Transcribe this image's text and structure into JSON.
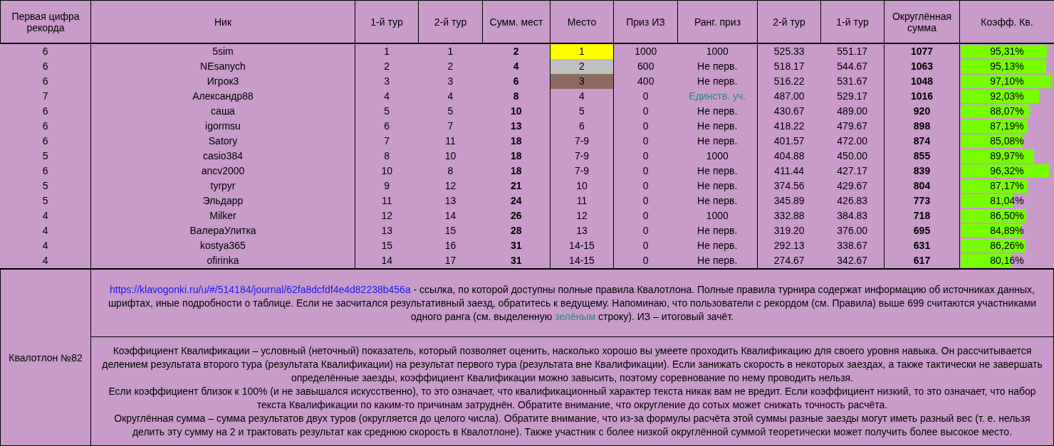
{
  "table": {
    "columns": [
      "Первая цифра рекорда",
      "Ник",
      "1-й тур",
      "2-й тур",
      "Сумм. мест",
      "Место",
      "Приз ИЗ",
      "Ранг. приз",
      "2-й тур",
      "1-й тур",
      "Округлённая сумма",
      "Коэфф. Кв."
    ],
    "rows": [
      {
        "record_digit": "6",
        "nick": "5sim",
        "round_1": "1",
        "round_2": "1",
        "sum_places": "2",
        "place": "1",
        "color": "#ffff00",
        "prize": "1000",
        "rank_prize": "1000",
        "highlighted": false,
        "score_2": "525.33",
        "score_1": "551.17",
        "rounded_sum": "1077",
        "coeff": "95,31%",
        "level": 0.915
      },
      {
        "record_digit": "6",
        "nick": "NEsanych",
        "round_1": "2",
        "round_2": "2",
        "sum_places": "4",
        "place": "2",
        "color": "#c0c0c0",
        "prize": "600",
        "rank_prize": "Не перв.",
        "highlighted": false,
        "score_2": "518.17",
        "score_1": "544.67",
        "rounded_sum": "1063",
        "coeff": "95,13%",
        "level": 0.911
      },
      {
        "record_digit": "6",
        "nick": "Игрок3",
        "round_1": "3",
        "round_2": "3",
        "sum_places": "6",
        "place": "3",
        "color": "#8b6b61",
        "prize": "400",
        "rank_prize": "Не перв.",
        "highlighted": false,
        "score_2": "516.22",
        "score_1": "531.67",
        "rounded_sum": "1048",
        "coeff": "97,10%",
        "level": 0.96
      },
      {
        "record_digit": "7",
        "nick": "Александр88",
        "round_1": "4",
        "round_2": "4",
        "sum_places": "8",
        "place": "4",
        "prize": "0",
        "rank_prize": "Единств. уч.",
        "highlighted": true,
        "score_2": "487.00",
        "score_1": "529.17",
        "rounded_sum": "1016",
        "coeff": "92,03%",
        "level": 0.833
      },
      {
        "record_digit": "6",
        "nick": "саша",
        "round_1": "5",
        "round_2": "5",
        "sum_places": "10",
        "place": "5",
        "prize": "0",
        "rank_prize": "Не перв.",
        "highlighted": false,
        "score_2": "430.67",
        "score_1": "489.00",
        "rounded_sum": "920",
        "coeff": "88,07%",
        "level": 0.734
      },
      {
        "record_digit": "6",
        "nick": "igormsu",
        "round_1": "6",
        "round_2": "7",
        "sum_places": "13",
        "place": "6",
        "prize": "0",
        "rank_prize": "Не перв.",
        "highlighted": false,
        "score_2": "418.22",
        "score_1": "479.67",
        "rounded_sum": "898",
        "coeff": "87,19%",
        "level": 0.711
      },
      {
        "record_digit": "6",
        "nick": "Satory",
        "round_1": "7",
        "round_2": "11",
        "sum_places": "18",
        "place": "7-9",
        "prize": "0",
        "rank_prize": "Не перв.",
        "highlighted": false,
        "score_2": "401.57",
        "score_1": "472.00",
        "rounded_sum": "874",
        "coeff": "85,08%",
        "level": 0.658
      },
      {
        "record_digit": "5",
        "nick": "casio384",
        "round_1": "8",
        "round_2": "10",
        "sum_places": "18",
        "place": "7-9",
        "prize": "0",
        "rank_prize": "1000",
        "highlighted": false,
        "score_2": "404.88",
        "score_1": "450.00",
        "rounded_sum": "855",
        "coeff": "89,97%",
        "level": 0.781
      },
      {
        "record_digit": "6",
        "nick": "ancv2000",
        "round_1": "10",
        "round_2": "8",
        "sum_places": "18",
        "place": "7-9",
        "prize": "0",
        "rank_prize": "Не перв.",
        "highlighted": false,
        "score_2": "411.44",
        "score_1": "427.17",
        "rounded_sum": "839",
        "coeff": "96,32%",
        "level": 0.941
      },
      {
        "record_digit": "5",
        "nick": "tyrpyr",
        "round_1": "9",
        "round_2": "12",
        "sum_places": "21",
        "place": "10",
        "prize": "0",
        "rank_prize": "Не перв.",
        "highlighted": false,
        "score_2": "374.56",
        "score_1": "429.67",
        "rounded_sum": "804",
        "coeff": "87,17%",
        "level": 0.711
      },
      {
        "record_digit": "5",
        "nick": "Эльдарр",
        "round_1": "11",
        "round_2": "13",
        "sum_places": "24",
        "place": "11",
        "prize": "0",
        "rank_prize": "Не перв.",
        "highlighted": false,
        "score_2": "345.89",
        "score_1": "426.83",
        "rounded_sum": "773",
        "coeff": "81,04%",
        "level": 0.557
      },
      {
        "record_digit": "4",
        "nick": "Milker",
        "round_1": "12",
        "round_2": "14",
        "sum_places": "26",
        "place": "12",
        "prize": "0",
        "rank_prize": "1000",
        "highlighted": false,
        "score_2": "332.88",
        "score_1": "384.83",
        "rounded_sum": "718",
        "coeff": "86,50%",
        "level": 0.694
      },
      {
        "record_digit": "4",
        "nick": "ВалераУлитка",
        "round_1": "13",
        "round_2": "15",
        "sum_places": "28",
        "place": "13",
        "prize": "0",
        "rank_prize": "Не перв.",
        "highlighted": false,
        "score_2": "319.20",
        "score_1": "376.00",
        "rounded_sum": "695",
        "coeff": "84,89%",
        "level": 0.654
      },
      {
        "record_digit": "4",
        "nick": "kostya365",
        "round_1": "15",
        "round_2": "16",
        "sum_places": "31",
        "place": "14-15",
        "prize": "0",
        "rank_prize": "Не перв.",
        "highlighted": false,
        "score_2": "292.13",
        "score_1": "338.67",
        "rounded_sum": "631",
        "coeff": "86,26%",
        "level": 0.688
      },
      {
        "record_digit": "4",
        "nick": "ofirinka",
        "round_1": "14",
        "round_2": "17",
        "sum_places": "31",
        "place": "14-15",
        "prize": "0",
        "rank_prize": "Не перв.",
        "highlighted": false,
        "score_2": "274.67",
        "score_1": "342.67",
        "rounded_sum": "617",
        "coeff": "80,16%",
        "level": 0.535
      }
    ]
  },
  "footer": {
    "label": "Квалотлон №82",
    "rules_note": [
      {
        "kind": "link",
        "text": "https://klavogonki.ru/u/#/514184/journal/62fa8dcfdf4e4d82238b456a"
      },
      {
        "kind": "text",
        "text": " - ссылка, по которой доступны полные правила Квалотлона. Полные правила турнира содержат информацию об источниках данных, шрифтах, иные подробности о таблице. Если не засчитался результативный заезд, обратитесь к ведущему. Напоминаю, что пользователи с рекордом (см. Правила) выше 699 считаются участниками одного ранга (см. выделенную "
      },
      {
        "kind": "highlight",
        "text": "зелёным"
      },
      {
        "kind": "text",
        "text": " строку). ИЗ – итоговый зачёт."
      }
    ],
    "explanation": [
      "Коэффициент Квалификации – условный (неточный) показатель, который позволяет оценить, насколько хорошо вы умеете проходить Квалификацию для своего уровня навыка. Он рассчитывается делением результата второго тура (результата Квалификации) на результат первого тура (результата вне Квалификации). Если занижать скорость в некоторых заездах, а также тактически не завершать определённые заезды, коэффициент Квалификации можно завысить, поэтому соревнование по нему проводить нельзя.",
      "Если коэффициент близок к 100% (и не завышался искусственно), то это означает, что квалификационный характер текста никак вам не вредит. Если коэффициент низкий, то это означает, что набор текста Квалификации по каким-то причинам затруднён. Обратите внимание, что округление до сотых может снижать точность расчёта.",
      "Округлённая сумма – сумма результатов двух туров (округляется до целого числа). Обратите внимание, что из-за формулы расчёта этой суммы разные заезды могут иметь разный вес (т. е. нельзя делить эту сумму на 2 и трактовать результат как среднюю скорость в Квалотлоне). Также участник с более низкой округлённой суммой теоретически может получить более высокое место."
    ]
  }
}
